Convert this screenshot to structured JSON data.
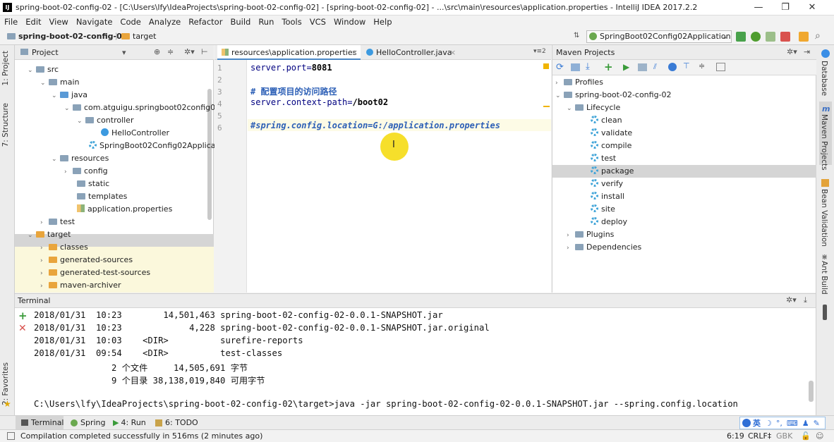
{
  "window": {
    "title": "spring-boot-02-config-02 - [C:\\Users\\lfy\\IdeaProjects\\spring-boot-02-config-02] - [spring-boot-02-config-02] - ...\\src\\main\\resources\\application.properties - IntelliJ IDEA 2017.2.2",
    "minimize": "—",
    "maximize": "❐",
    "close": "✕"
  },
  "menu": [
    "File",
    "Edit",
    "View",
    "Navigate",
    "Code",
    "Analyze",
    "Refactor",
    "Build",
    "Run",
    "Tools",
    "VCS",
    "Window",
    "Help"
  ],
  "breadcrumb": {
    "project": "spring-boot-02-config-02",
    "folder": "target"
  },
  "run_config": "SpringBoot02Config02Application",
  "left_strip": {
    "project": "1: Project",
    "structure": "7: Structure",
    "favorites": "2: Favorites"
  },
  "right_strip": {
    "database": "Database",
    "maven": "Maven Projects",
    "bean": "Bean Validation",
    "ant": "Ant Build"
  },
  "project_panel": {
    "title": "Project",
    "tree": [
      {
        "label": "src",
        "arrow": "⌄",
        "icon": "grey"
      },
      {
        "label": "main",
        "arrow": "⌄",
        "icon": "grey"
      },
      {
        "label": "java",
        "arrow": "⌄",
        "icon": "blue"
      },
      {
        "label": "com.atguigu.springboot02config02",
        "arrow": "⌄",
        "icon": "grey"
      },
      {
        "label": "controller",
        "arrow": "⌄",
        "icon": "grey"
      },
      {
        "label": "HelloController",
        "arrow": "",
        "icon": "class"
      },
      {
        "label": "SpringBoot02Config02Applicatic",
        "arrow": "",
        "icon": "springclass"
      },
      {
        "label": "resources",
        "arrow": "⌄",
        "icon": "grey"
      },
      {
        "label": "config",
        "arrow": "›",
        "icon": "grey"
      },
      {
        "label": "static",
        "arrow": "",
        "icon": "grey"
      },
      {
        "label": "templates",
        "arrow": "",
        "icon": "grey"
      },
      {
        "label": "application.properties",
        "arrow": "",
        "icon": "file"
      },
      {
        "label": "test",
        "arrow": "›",
        "icon": "grey"
      },
      {
        "label": "target",
        "arrow": "⌄",
        "icon": "orange"
      },
      {
        "label": "classes",
        "arrow": "›",
        "icon": "orange"
      },
      {
        "label": "generated-sources",
        "arrow": "›",
        "icon": "orange"
      },
      {
        "label": "generated-test-sources",
        "arrow": "›",
        "icon": "orange"
      },
      {
        "label": "maven-archiver",
        "arrow": "›",
        "icon": "orange"
      }
    ]
  },
  "editor": {
    "tabs": [
      {
        "label": "resources\\application.properties",
        "active": true
      },
      {
        "label": "HelloController.java",
        "active": false
      }
    ],
    "tab_close": "×",
    "tab_overflow": "▾≡2",
    "line_numbers": [
      "1",
      "2",
      "3",
      "4",
      "5",
      "6"
    ],
    "lines": {
      "l1_key": "server.port=",
      "l1_val": "8081",
      "l3": "# 配置项目的访问路径",
      "l4_key": "server.context-path=",
      "l4_val": "/boot02",
      "l6": "#spring.config.location=G:/application.properties"
    }
  },
  "maven_panel": {
    "title": "Maven Projects",
    "profiles": "Profiles",
    "project": "spring-boot-02-config-02",
    "lifecycle": "Lifecycle",
    "goals": [
      "clean",
      "validate",
      "compile",
      "test",
      "package",
      "verify",
      "install",
      "site",
      "deploy"
    ],
    "selected_goal": "package",
    "plugins": "Plugins",
    "dependencies": "Dependencies"
  },
  "terminal": {
    "title": "Terminal",
    "lines": [
      "2018/01/31  10:23        14,501,463 spring-boot-02-config-02-0.0.1-SNAPSHOT.jar",
      "2018/01/31  10:23             4,228 spring-boot-02-config-02-0.0.1-SNAPSHOT.jar.original",
      "2018/01/31  10:03    <DIR>          surefire-reports",
      "2018/01/31  09:54    <DIR>          test-classes",
      "               2 个文件     14,505,691 字节",
      "               9 个目录 38,138,019,840 可用字节",
      "",
      "C:\\Users\\lfy\\IdeaProjects\\spring-boot-02-config-02\\target>java -jar spring-boot-02-config-02-0.0.1-SNAPSHOT.jar --spring.config.location"
    ]
  },
  "bottom_tabs": [
    {
      "label": "Terminal",
      "icon": "terminal-icon"
    },
    {
      "label": "Spring",
      "icon": "spring-icon"
    },
    {
      "label": "4: Run",
      "icon": "run-icon"
    },
    {
      "label": "6: TODO",
      "icon": "todo-icon"
    }
  ],
  "ime": "英",
  "status": {
    "message": "Compilation completed successfully in 516ms (2 minutes ago)",
    "position": "6:19",
    "line_sep": "CRLF‡",
    "encoding": "GBK"
  },
  "colors": {
    "accent": "#4a88c7",
    "selected_row": "#d5d5d5",
    "target_highlight": "#fbf8dc",
    "cursor_highlight": "#f5dc14"
  }
}
